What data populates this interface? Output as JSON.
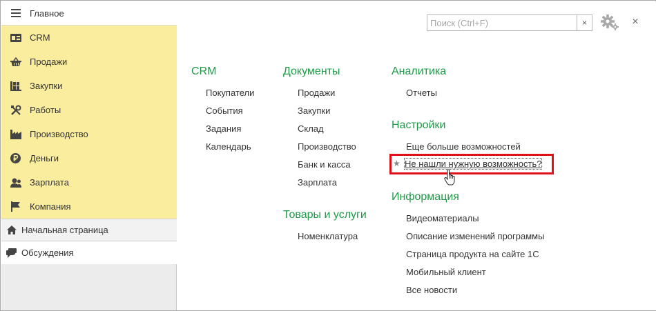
{
  "sidebar": {
    "home": {
      "label": "Главное",
      "icon": "menu-lines-icon"
    },
    "sections": [
      {
        "label": "CRM",
        "icon": "crm-card-icon"
      },
      {
        "label": "Продажи",
        "icon": "basket-icon"
      },
      {
        "label": "Закупки",
        "icon": "supplies-icon"
      },
      {
        "label": "Работы",
        "icon": "tools-icon"
      },
      {
        "label": "Производство",
        "icon": "factory-icon"
      },
      {
        "label": "Деньги",
        "icon": "ruble-coin-icon"
      },
      {
        "label": "Зарплата",
        "icon": "person-icon"
      },
      {
        "label": "Компания",
        "icon": "flag-icon"
      }
    ],
    "start_page": {
      "label": "Начальная страница",
      "icon": "house-icon"
    },
    "discussions": {
      "label": "Обсуждения",
      "icon": "chat-icon"
    }
  },
  "search": {
    "placeholder": "Поиск (Ctrl+F)",
    "value": "",
    "clear_label": "×"
  },
  "close_label": "×",
  "columns": {
    "crm": {
      "title": "CRM",
      "items": [
        "Покупатели",
        "События",
        "Задания",
        "Календарь"
      ]
    },
    "documents": {
      "title": "Документы",
      "items": [
        "Продажи",
        "Закупки",
        "Склад",
        "Производство",
        "Банк и касса",
        "Зарплата"
      ]
    },
    "goods": {
      "title": "Товары и услуги",
      "items": [
        "Номенклатура"
      ]
    },
    "analytics": {
      "title": "Аналитика",
      "items": [
        "Отчеты"
      ]
    },
    "settings": {
      "title": "Настройки",
      "items": [
        "Еще больше возможностей"
      ],
      "highlighted_item": "Не нашли нужную возможность?",
      "star": "★"
    },
    "info": {
      "title": "Информация",
      "items": [
        "Видеоматериалы",
        "Описание изменений программы",
        "Страница продукта на сайте 1С",
        "Мобильный клиент",
        "Все новости"
      ]
    }
  },
  "colors": {
    "accent_green": "#1e9a47",
    "sidebar_yellow": "#fbed9e",
    "highlight_red": "#e0101a"
  }
}
